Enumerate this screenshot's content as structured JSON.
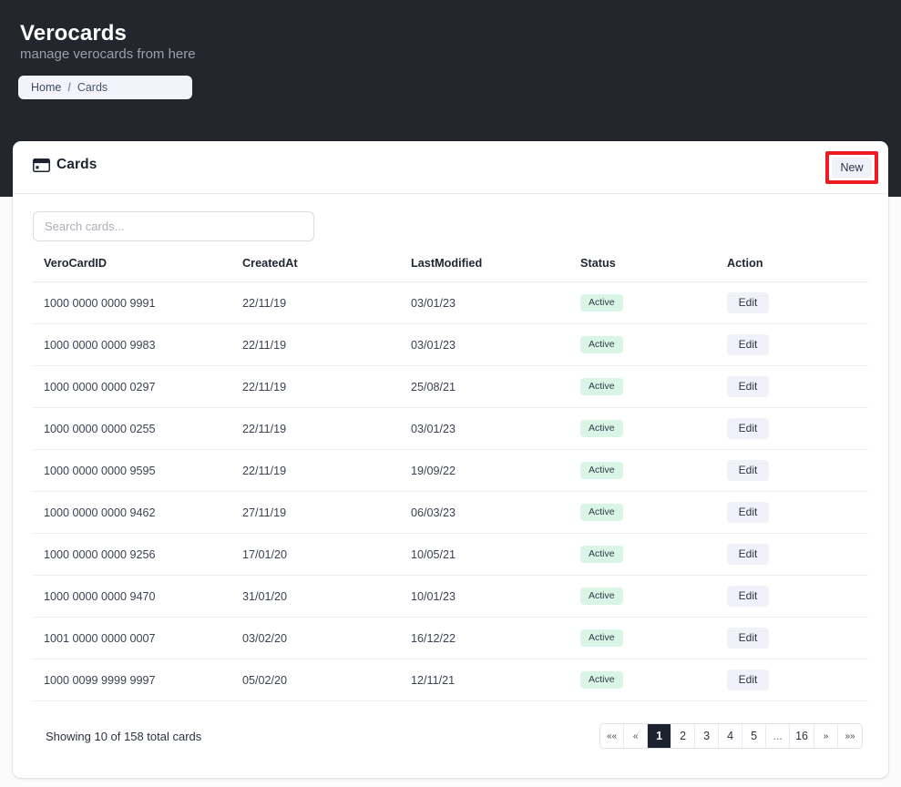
{
  "header": {
    "app_title": "Verocards",
    "app_subtitle": "manage verocards from here",
    "breadcrumb": {
      "home": "Home",
      "separator": "/",
      "current": "Cards"
    }
  },
  "card": {
    "title": "Cards",
    "icon": "credit-card-icon",
    "new_label": "New",
    "highlight_color": "#ed1c24"
  },
  "search": {
    "placeholder": "Search cards...",
    "value": ""
  },
  "table": {
    "columns": [
      "VeroCardID",
      "CreatedAt",
      "LastModified",
      "Status",
      "Action"
    ],
    "action_label": "Edit",
    "rows": [
      {
        "id": "1000 0000 0000 9991",
        "created": "22/11/19",
        "modified": "03/01/23",
        "status": "Active",
        "action": "Edit"
      },
      {
        "id": "1000 0000 0000 9983",
        "created": "22/11/19",
        "modified": "03/01/23",
        "status": "Active",
        "action": "Edit"
      },
      {
        "id": "1000 0000 0000 0297",
        "created": "22/11/19",
        "modified": "25/08/21",
        "status": "Active",
        "action": "Edit"
      },
      {
        "id": "1000 0000 0000 0255",
        "created": "22/11/19",
        "modified": "03/01/23",
        "status": "Active",
        "action": "Edit"
      },
      {
        "id": "1000 0000 0000 9595",
        "created": "22/11/19",
        "modified": "19/09/22",
        "status": "Active",
        "action": "Edit"
      },
      {
        "id": "1000 0000 0000 9462",
        "created": "27/11/19",
        "modified": "06/03/23",
        "status": "Active",
        "action": "Edit"
      },
      {
        "id": "1000 0000 0000 9256",
        "created": "17/01/20",
        "modified": "10/05/21",
        "status": "Active",
        "action": "Edit"
      },
      {
        "id": "1000 0000 0000 9470",
        "created": "31/01/20",
        "modified": "10/01/23",
        "status": "Active",
        "action": "Edit"
      },
      {
        "id": "1001 0000 0000 0007",
        "created": "03/02/20",
        "modified": "16/12/22",
        "status": "Active",
        "action": "Edit"
      },
      {
        "id": "1000 0099 9999 9997",
        "created": "05/02/20",
        "modified": "12/11/21",
        "status": "Active",
        "action": "Edit"
      }
    ]
  },
  "footer": {
    "showing_text": "Showing 10 of 158 total cards",
    "pagination": {
      "current_page": "1",
      "items": [
        {
          "label": "««",
          "type": "first"
        },
        {
          "label": "«",
          "type": "prev"
        },
        {
          "label": "1",
          "type": "page"
        },
        {
          "label": "2",
          "type": "page"
        },
        {
          "label": "3",
          "type": "page"
        },
        {
          "label": "4",
          "type": "page"
        },
        {
          "label": "5",
          "type": "page"
        },
        {
          "label": "...",
          "type": "ellipsis"
        },
        {
          "label": "16",
          "type": "page"
        },
        {
          "label": "»",
          "type": "next"
        },
        {
          "label": "»»",
          "type": "last"
        }
      ]
    }
  },
  "colors": {
    "header_bg": "#24262d",
    "badge_active_bg": "#d9f5e6",
    "pager_active_bg": "#1c2230",
    "highlight": "#ed1c24"
  }
}
